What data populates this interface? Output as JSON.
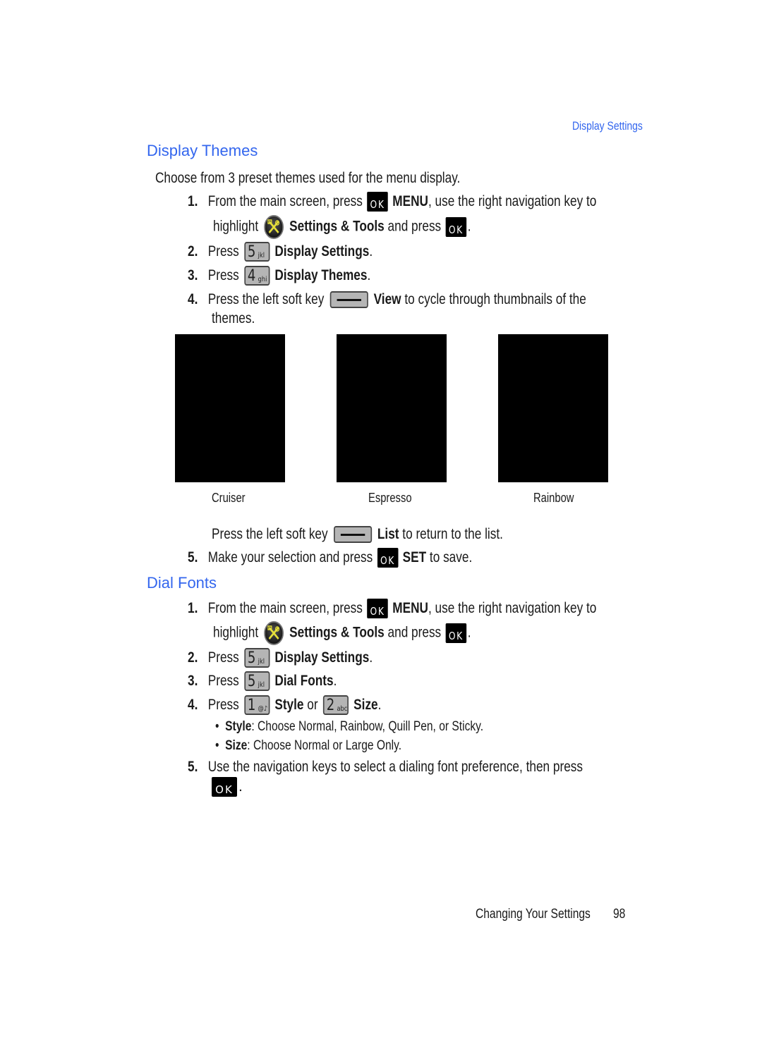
{
  "running_head": "Display Settings",
  "display_themes": {
    "title": "Display Themes",
    "intro": "Choose from 3 preset themes used for the menu display.",
    "steps": [
      {
        "num": "1.",
        "pre": "From the main screen, press",
        "key": "OK",
        "bold": "MENU",
        "post": ", use the right navigation key to",
        "cont_pre": "highlight",
        "cont_bold": "Settings & Tools",
        "cont_post": " and press",
        "cont_end": "."
      },
      {
        "num": "2.",
        "pre": "Press",
        "key_digit": "5",
        "key_letters": "jkl",
        "bold": "Display Settings",
        "post": "."
      },
      {
        "num": "3.",
        "pre": "Press",
        "key_digit": "4",
        "key_letters": "ghi",
        "bold": "Display Themes",
        "post": "."
      },
      {
        "num": "4.",
        "pre": "Press the left soft key",
        "bold": "View",
        "post": " to cycle through thumbnails of the",
        "cont": "themes."
      }
    ],
    "themes": [
      "Cruiser",
      "Espresso",
      "Rainbow"
    ],
    "list_line": {
      "pre": "Press the left soft key",
      "bold": "List",
      "post": " to return to the list."
    },
    "step5": {
      "num": "5.",
      "pre": "Make your selection and press",
      "bold": "SET",
      "post": " to save."
    }
  },
  "dial_fonts": {
    "title": "Dial Fonts",
    "steps": [
      {
        "num": "1.",
        "pre": "From the main screen, press",
        "bold": "MENU",
        "post": ", use the right navigation key to",
        "cont_pre": "highlight",
        "cont_bold": "Settings & Tools",
        "cont_post": " and press",
        "cont_end": "."
      },
      {
        "num": "2.",
        "pre": "Press",
        "key_digit": "5",
        "key_letters": "jkl",
        "bold": "Display Settings",
        "post": "."
      },
      {
        "num": "3.",
        "pre": "Press",
        "key_digit": "5",
        "key_letters": "jkl",
        "bold": "Dial Fonts",
        "post": "."
      },
      {
        "num": "4.",
        "pre": "Press",
        "key1_digit": "1",
        "key1_letters": "@♪",
        "bold1": "Style",
        "mid": " or ",
        "key2_digit": "2",
        "key2_letters": "abc",
        "bold2": "Size",
        "post": "."
      }
    ],
    "bullets": [
      {
        "bold": "Style",
        "text": ": Choose Normal, Rainbow, Quill Pen, or Sticky."
      },
      {
        "bold": "Size",
        "text": ": Choose Normal or Large Only."
      }
    ],
    "step5": {
      "num": "5.",
      "text": "Use the navigation keys to select a dialing font preference, then press",
      "end": "."
    }
  },
  "keys": {
    "ok_label": "OK"
  },
  "footer": {
    "section": "Changing Your Settings",
    "page": "98"
  }
}
